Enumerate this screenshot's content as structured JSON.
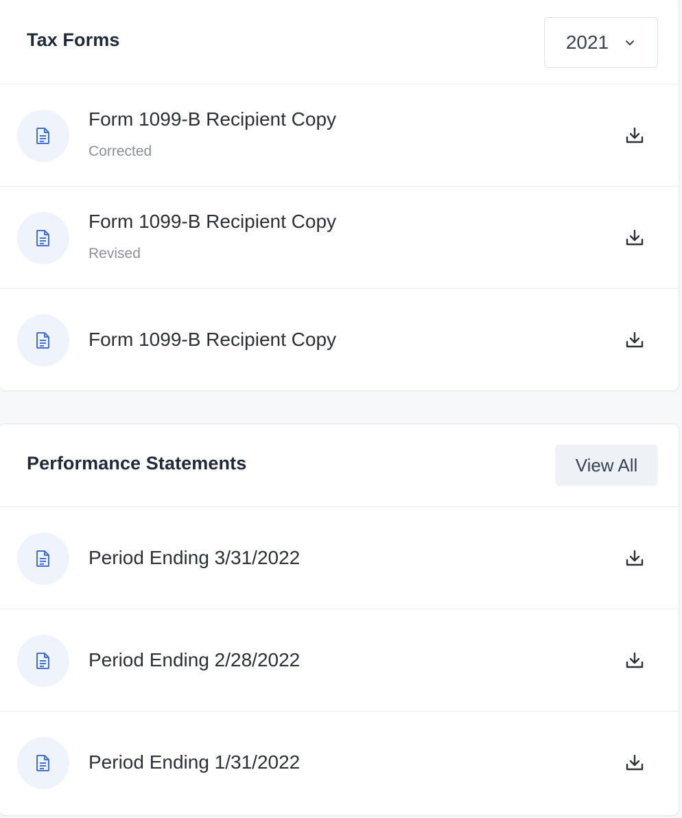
{
  "tax_forms": {
    "title": "Tax Forms",
    "year_select": {
      "value": "2021",
      "icon": "chevron-down-icon"
    },
    "items": [
      {
        "title": "Form 1099-B Recipient Copy",
        "subtitle": "Corrected",
        "icon": "document-icon",
        "action_icon": "download-icon"
      },
      {
        "title": "Form 1099-B Recipient Copy",
        "subtitle": "Revised",
        "icon": "document-icon",
        "action_icon": "download-icon"
      },
      {
        "title": "Form 1099-B Recipient Copy",
        "icon": "document-icon",
        "action_icon": "download-icon"
      }
    ]
  },
  "performance_statements": {
    "title": "Performance Statements",
    "view_all_label": "View All",
    "items": [
      {
        "title": "Period Ending 3/31/2022",
        "icon": "document-icon",
        "action_icon": "download-icon"
      },
      {
        "title": "Period Ending 2/28/2022",
        "icon": "document-icon",
        "action_icon": "download-icon"
      },
      {
        "title": "Period Ending 1/31/2022",
        "icon": "document-icon",
        "action_icon": "download-icon"
      }
    ]
  },
  "colors": {
    "accent": "#3f6fd8",
    "icon_bg": "#eef3fc",
    "text_primary": "#2b2f36",
    "text_muted": "#8a9099",
    "button_bg": "#eef1f6"
  }
}
